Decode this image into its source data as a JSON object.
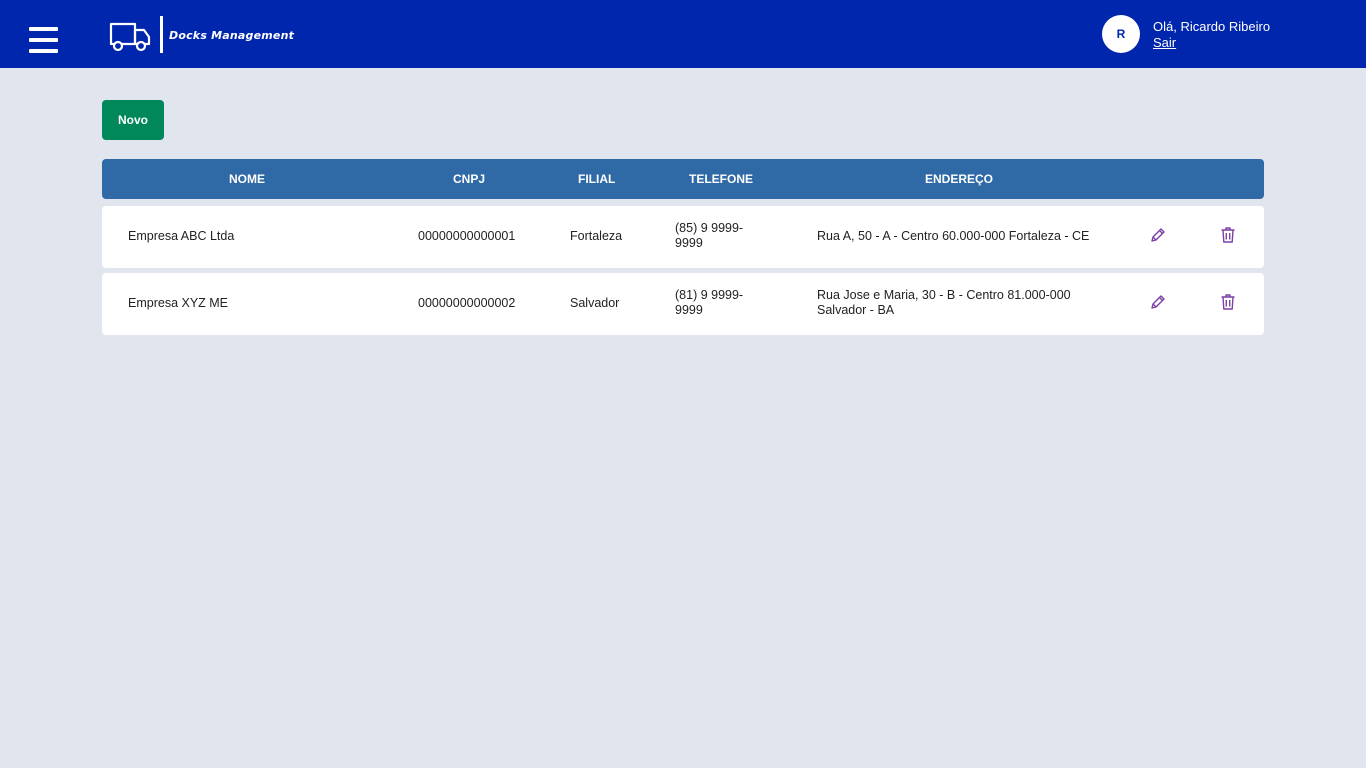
{
  "header": {
    "app_name": "Docks Management",
    "avatar_initial": "R",
    "greeting": "Olá, Ricardo Ribeiro",
    "logout_label": "Sair",
    "bg_color": "#0026ad"
  },
  "toolbar": {
    "new_label": "Novo",
    "new_color": "#00875a"
  },
  "table": {
    "columns": [
      "NOME",
      "CNPJ",
      "FILIAL",
      "TELEFONE",
      "ENDEREÇO"
    ],
    "header_color": "#2f6aa6",
    "rows": [
      {
        "nome": "Empresa ABC Ltda",
        "cnpj": "00000000000001",
        "filial": "Fortaleza",
        "telefone": "(85) 9 9999-9999",
        "endereco": "Rua A, 50 - A - Centro 60.000-000 Fortaleza - CE"
      },
      {
        "nome": "Empresa XYZ ME",
        "cnpj": "00000000000002",
        "filial": "Salvador",
        "telefone": "(81) 9 9999-9999",
        "endereco": "Rua Jose e Maria, 30 - B - Centro 81.000-000 Salvador - BA"
      }
    ],
    "row_icons": [
      "pencil-icon",
      "trash-icon"
    ],
    "icon_color": "#7b3fa6"
  }
}
